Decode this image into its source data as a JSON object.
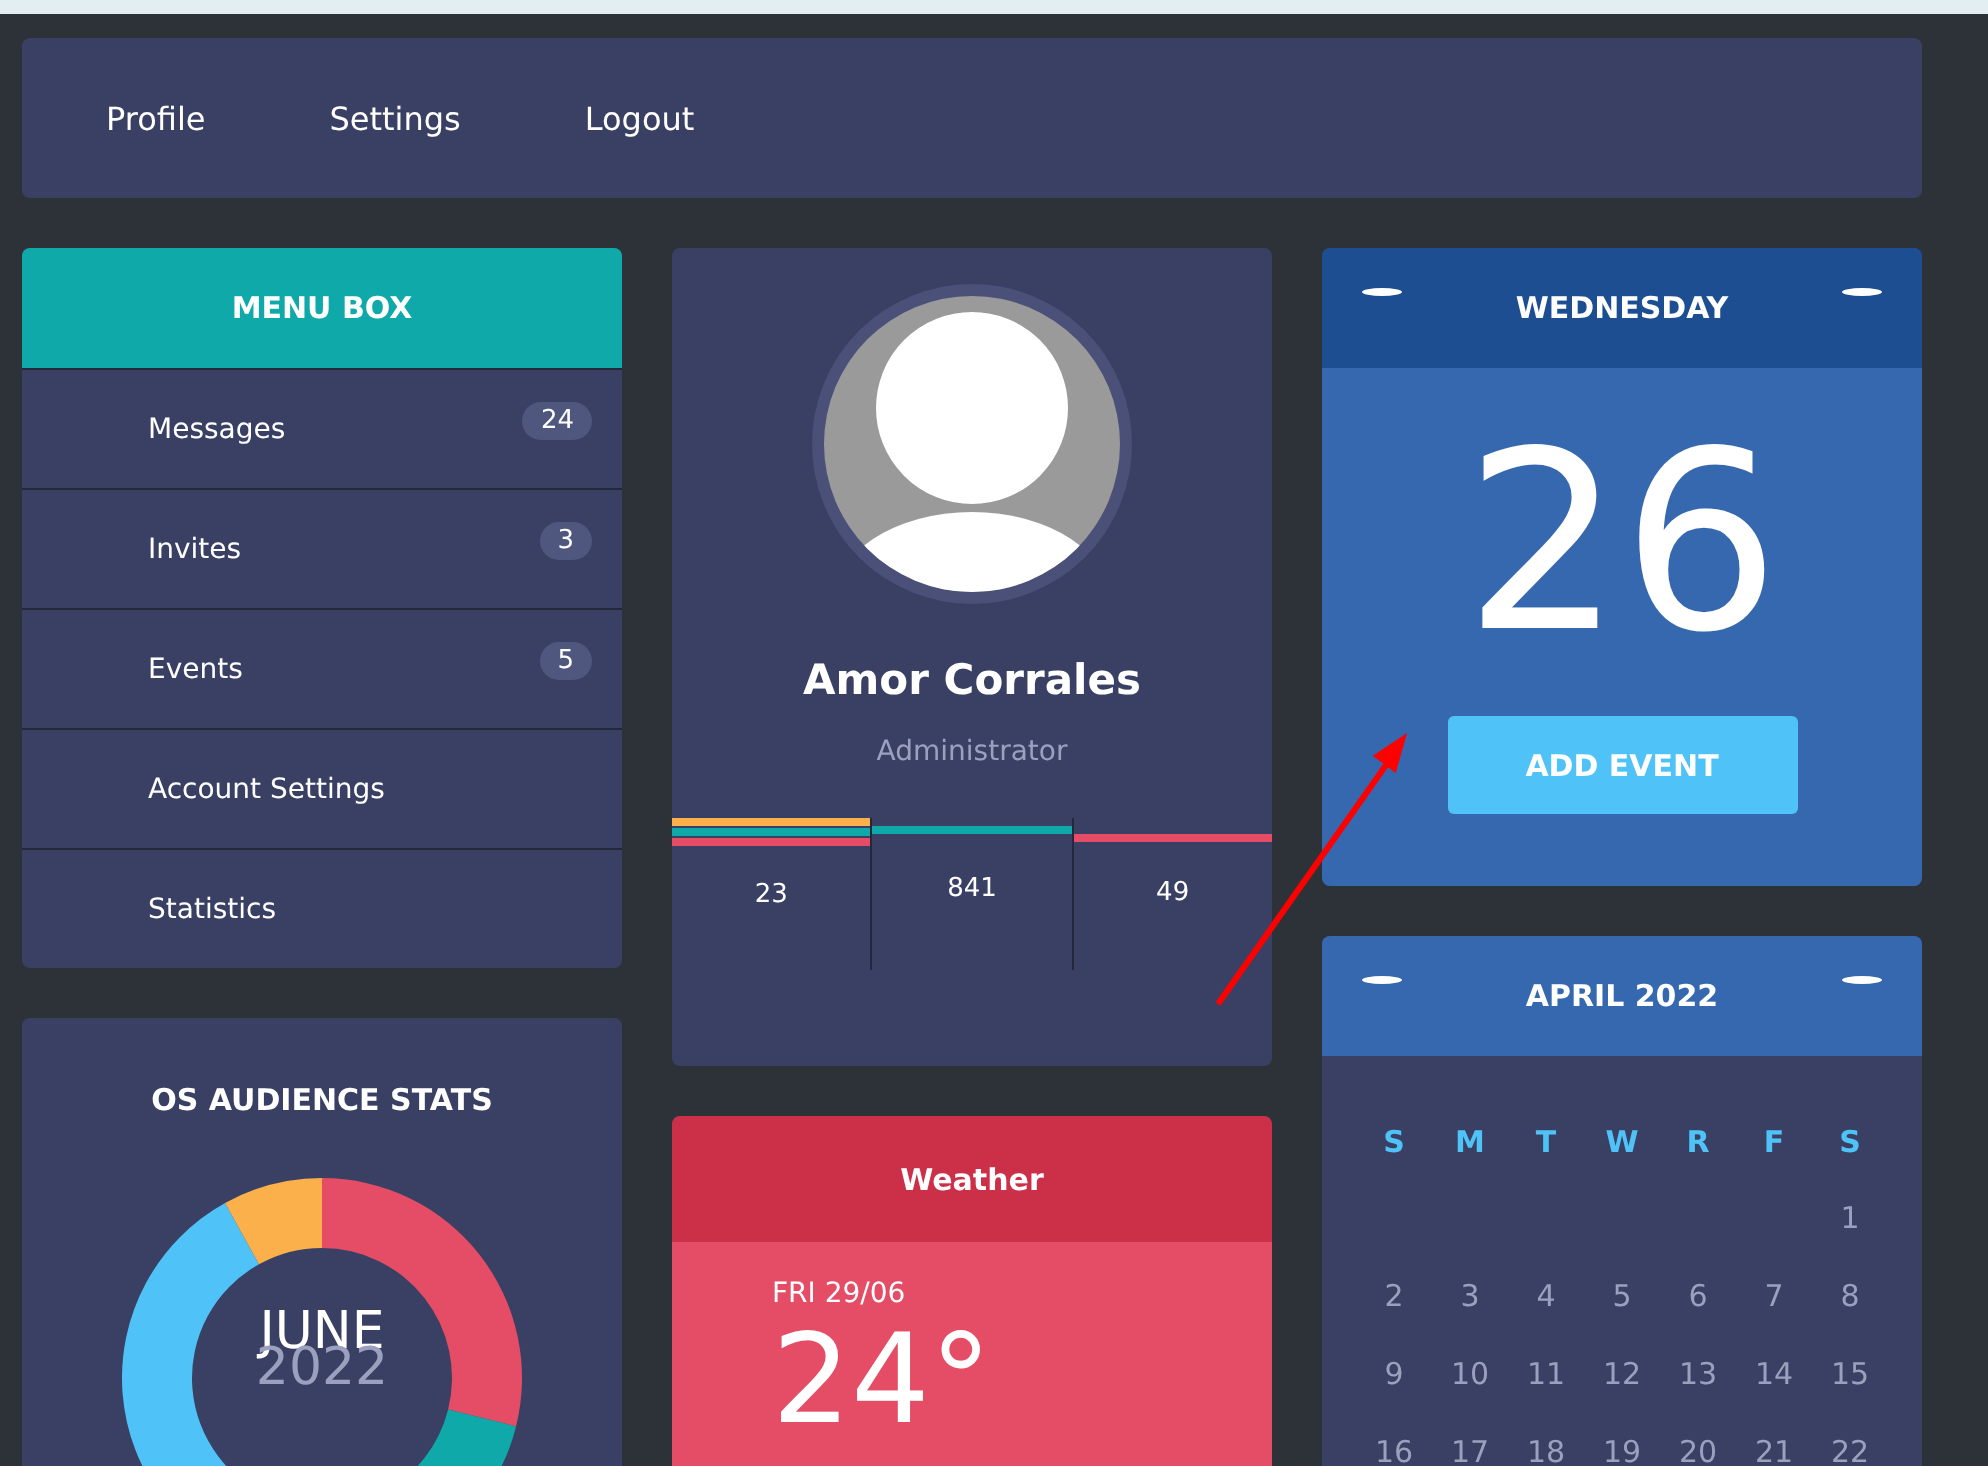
{
  "nav": {
    "links": [
      "Profile",
      "Settings",
      "Logout"
    ]
  },
  "menu_box": {
    "title": "MENU BOX",
    "items": [
      {
        "label": "Messages",
        "badge": "24"
      },
      {
        "label": "Invites",
        "badge": "3"
      },
      {
        "label": "Events",
        "badge": "5"
      },
      {
        "label": "Account Settings"
      },
      {
        "label": "Statistics"
      }
    ]
  },
  "os_audience_stats": {
    "title": "OS AUDIENCE STATS",
    "center_month": "JUNE",
    "center_year": "2022"
  },
  "profile": {
    "name": "Amor Corrales",
    "role": "Administrator",
    "stats": [
      "23",
      "841",
      "49"
    ]
  },
  "weather": {
    "title": "Weather",
    "date": "FRI 29/06",
    "temperature": "24°"
  },
  "date_card": {
    "weekday": "WEDNESDAY",
    "day": "26",
    "button": "ADD EVENT"
  },
  "calendar": {
    "title": "APRIL 2022",
    "weekdays": [
      "S",
      "M",
      "T",
      "W",
      "R",
      "F",
      "S"
    ],
    "weeks": [
      [
        "1"
      ],
      [
        "2",
        "3",
        "4",
        "5",
        "6",
        "7",
        "8"
      ],
      [
        "9",
        "10",
        "11",
        "12",
        "13",
        "14",
        "15"
      ],
      [
        "16",
        "17",
        "18",
        "19",
        "20",
        "21",
        "22"
      ]
    ]
  }
}
